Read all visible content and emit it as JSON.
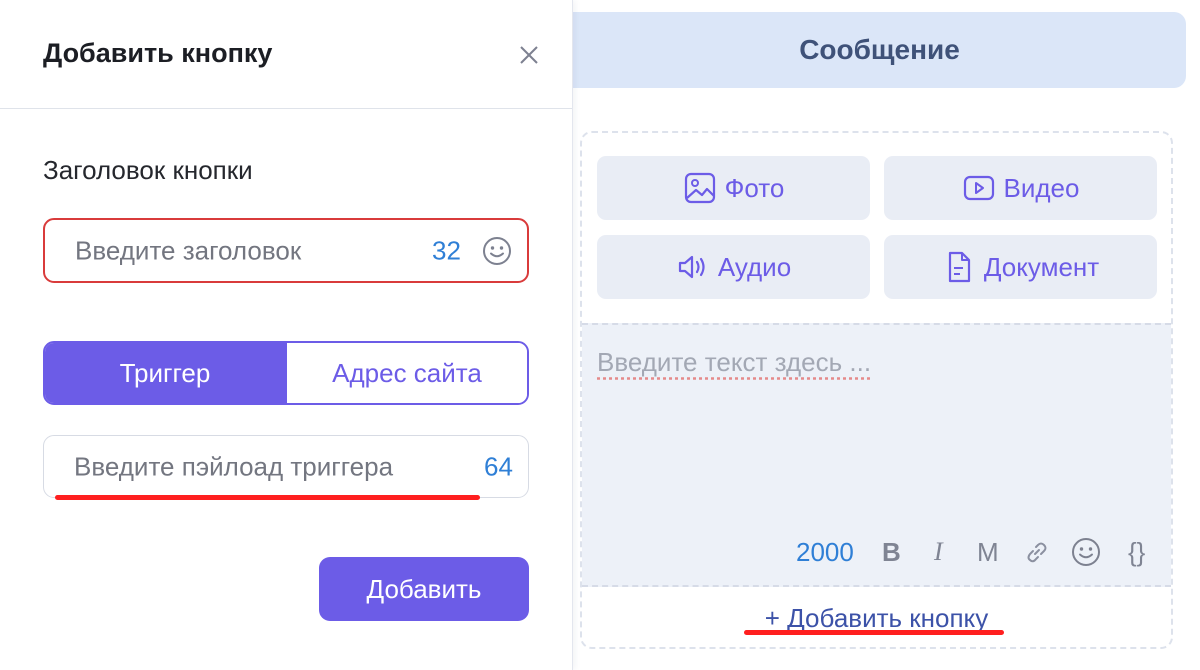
{
  "modal": {
    "title": "Добавить кнопку",
    "field_label": "Заголовок кнопки",
    "title_input": {
      "placeholder": "Введите заголовок",
      "value": "",
      "counter": "32"
    },
    "tabs": [
      {
        "label": "Триггер",
        "active": true
      },
      {
        "label": "Адрес сайта",
        "active": false
      }
    ],
    "payload_input": {
      "placeholder": "Введите пэйлоад триггера",
      "value": "",
      "counter": "64"
    },
    "add_button": "Добавить"
  },
  "message": {
    "header": "Сообщение",
    "media": [
      {
        "label": "Фото",
        "icon": "photo-icon"
      },
      {
        "label": "Видео",
        "icon": "video-icon"
      },
      {
        "label": "Аудио",
        "icon": "audio-icon"
      },
      {
        "label": "Документ",
        "icon": "document-icon"
      }
    ],
    "text_placeholder": "Введите текст здесь ...",
    "char_counter": "2000",
    "toolbar": {
      "bold": "B",
      "italic": "I",
      "mono": "M",
      "variables": "{}"
    },
    "add_button_link": "+ Добавить кнопку"
  },
  "colors": {
    "accent": "#6c5ce7",
    "counter": "#2f7fd6",
    "error_border": "#d93b3b",
    "annotation": "#ff1f1f",
    "header_bg": "#dbe6f8"
  }
}
